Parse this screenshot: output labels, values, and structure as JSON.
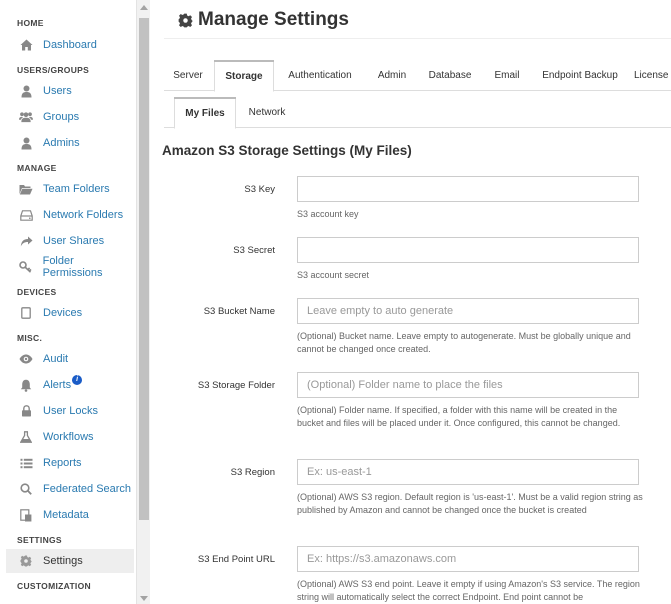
{
  "sidebar": {
    "sections": {
      "home": "HOME",
      "users_groups": "USERS/GROUPS",
      "manage": "MANAGE",
      "devices": "DEVICES",
      "misc": "MISC.",
      "settings": "SETTINGS",
      "customization": "CUSTOMIZATION"
    },
    "items": {
      "dashboard": "Dashboard",
      "users": "Users",
      "groups": "Groups",
      "admins": "Admins",
      "team_folders": "Team Folders",
      "network_folders": "Network Folders",
      "user_shares": "User Shares",
      "folder_permissions": "Folder Permissions",
      "devices": "Devices",
      "audit": "Audit",
      "alerts": "Alerts",
      "user_locks": "User Locks",
      "workflows": "Workflows",
      "reports": "Reports",
      "federated_search": "Federated Search",
      "metadata": "Metadata",
      "settings": "Settings"
    },
    "alerts_badge": "i"
  },
  "header": {
    "title": "Manage Settings"
  },
  "tabs": {
    "server": "Server",
    "storage": "Storage",
    "authentication": "Authentication",
    "admin": "Admin",
    "database": "Database",
    "email": "Email",
    "endpoint_backup": "Endpoint Backup",
    "license": "License"
  },
  "subtabs": {
    "my_files": "My Files",
    "network": "Network"
  },
  "section_heading": "Amazon S3 Storage Settings (My Files)",
  "form": {
    "s3_key": {
      "label": "S3 Key",
      "value": "",
      "placeholder": "",
      "help": "S3 account key"
    },
    "s3_secret": {
      "label": "S3 Secret",
      "value": "",
      "placeholder": "",
      "help": "S3 account secret"
    },
    "s3_bucket": {
      "label": "S3 Bucket Name",
      "value": "",
      "placeholder": "Leave empty to auto generate",
      "help": "(Optional) Bucket name. Leave empty to autogenerate. Must be globally unique and cannot be changed once created."
    },
    "s3_folder": {
      "label": "S3 Storage Folder",
      "value": "",
      "placeholder": "(Optional) Folder name to place the files",
      "help": "(Optional) Folder name. If specified, a folder with this name will be created in the bucket and files will be placed under it. Once configured, this cannot be changed."
    },
    "s3_region": {
      "label": "S3 Region",
      "value": "",
      "placeholder": "Ex: us-east-1",
      "help": "(Optional) AWS S3 region. Default region is 'us-east-1'. Must be a valid region string as published by Amazon and cannot be changed once the bucket is created"
    },
    "s3_endpoint": {
      "label": "S3 End Point URL",
      "value": "",
      "placeholder": "Ex: https://s3.amazonaws.com",
      "help": "(Optional) AWS S3 end point. Leave it empty if using Amazon's S3 service. The region string will automatically select the correct Endpoint. End point cannot be"
    }
  }
}
